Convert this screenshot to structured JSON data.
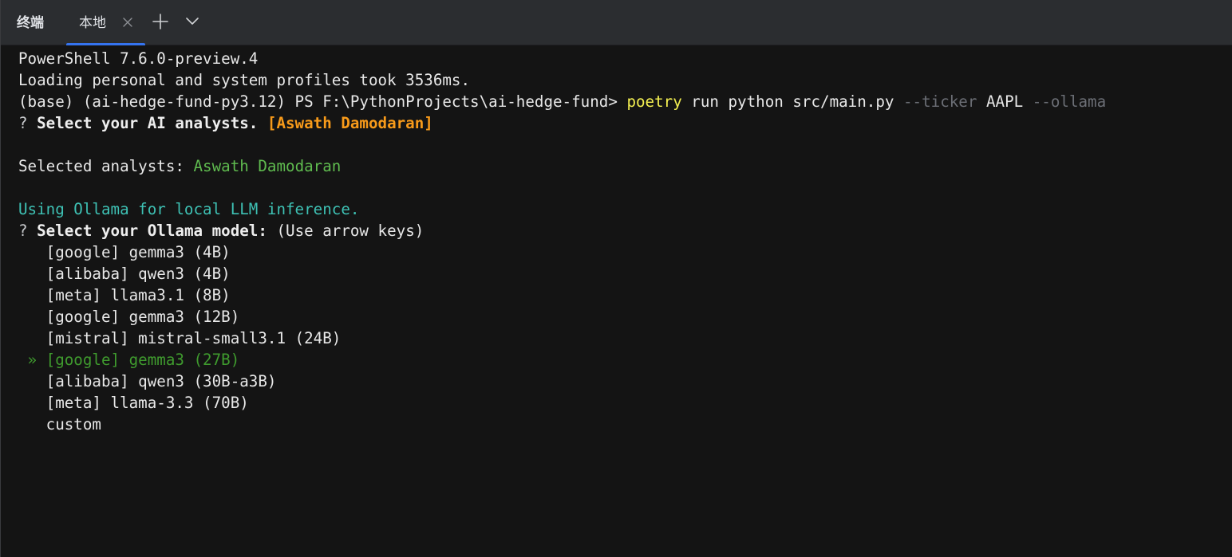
{
  "tabbar": {
    "panel_title": "终端",
    "tabs": [
      {
        "label": "本地",
        "active": true
      }
    ],
    "icons": {
      "close": "close-icon",
      "add": "plus-icon",
      "menu": "chevron-down-icon"
    },
    "accent_color": "#3574f0"
  },
  "terminal": {
    "banner": {
      "version": "PowerShell 7.6.0-preview.4",
      "profiles": "Loading personal and system profiles took 3536ms."
    },
    "command_line": {
      "prompt": "(base) (ai-hedge-fund-py3.12) PS F:\\PythonProjects\\ai-hedge-fund> ",
      "cmd": "poetry",
      "args1": " run python src/main.py ",
      "flag_ticker": "--ticker",
      "ticker_value": " AAPL ",
      "flag_ollama": "--ollama"
    },
    "analysts_question": {
      "mark": "? ",
      "text": "Select your AI analysts. ",
      "answer": "[Aswath Damodaran]"
    },
    "selected_analysts": {
      "label": "Selected analysts: ",
      "value": "Aswath Damodaran"
    },
    "ollama_notice": "Using Ollama for local LLM inference.",
    "model_question": {
      "mark": "? ",
      "text": "Select your Ollama model: ",
      "hint": "(Use arrow keys)"
    },
    "pointer": " » ",
    "model_options": [
      {
        "label": "[google] gemma3 (4B)",
        "selected": false
      },
      {
        "label": "[alibaba] qwen3 (4B)",
        "selected": false
      },
      {
        "label": "[meta] llama3.1 (8B)",
        "selected": false
      },
      {
        "label": "[google] gemma3 (12B)",
        "selected": false
      },
      {
        "label": "[mistral] mistral-small3.1 (24B)",
        "selected": false
      },
      {
        "label": "[google] gemma3 (27B)",
        "selected": true
      },
      {
        "label": "[alibaba] qwen3 (30B-a3B)",
        "selected": false
      },
      {
        "label": "[meta] llama-3.3 (70B)",
        "selected": false
      },
      {
        "label": "custom",
        "selected": false
      }
    ],
    "colors": {
      "background": "#141414",
      "text": "#e8e8e8",
      "command": "#f3ef51",
      "flag": "#6b6e75",
      "answer": "#f79a1a",
      "selected_value": "#5fbb4f",
      "notice": "#3ec1b4",
      "highlighted_option": "#3f9b2e"
    }
  }
}
